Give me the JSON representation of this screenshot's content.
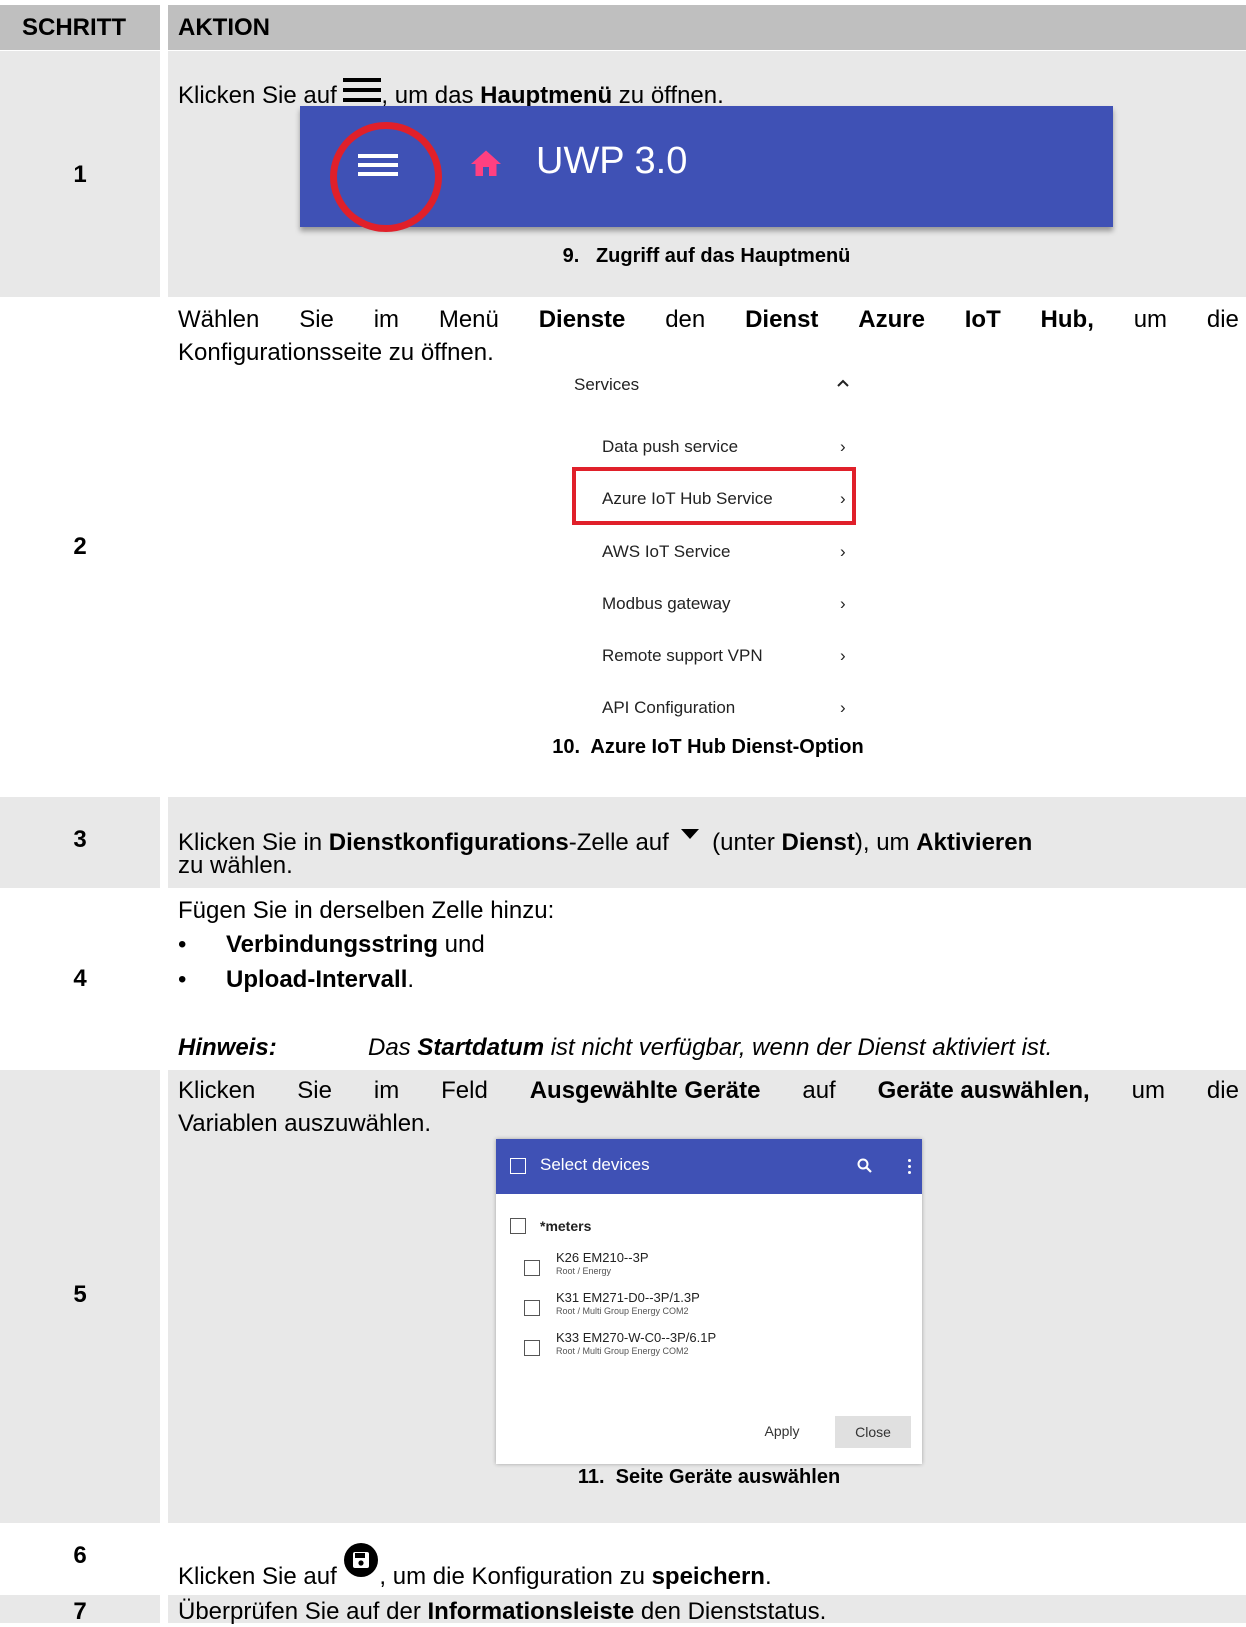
{
  "header": {
    "col_step": "SCHRITT",
    "col_action": "AKTION"
  },
  "step1": {
    "num": "1",
    "text_a": "Klicken Sie auf ",
    "text_b": ", um das ",
    "text_bold": "Hauptmenü",
    "text_c": " zu öffnen.",
    "app_title": "UWP 3.0",
    "caption": "9.   Zugriff auf das Hauptmenü"
  },
  "step2": {
    "num": "2",
    "line1": [
      "Wählen",
      "Sie",
      "im",
      "Menü",
      "Dienste",
      "den",
      "Dienst",
      "Azure",
      "IoT",
      "Hub,",
      "um",
      "die"
    ],
    "line2": "Konfigurationsseite zu öffnen.",
    "menu_header": "Services",
    "menu_items": [
      "Data push service",
      "Azure IoT Hub Service",
      "AWS IoT Service",
      "Modbus gateway",
      "Remote support VPN",
      "API Configuration"
    ],
    "caption": "10.  Azure IoT Hub Dienst-Option"
  },
  "step3": {
    "num": "3",
    "a": "Klicken Sie in ",
    "b": "Dienstkonfigurations",
    "c": "-Zelle auf ",
    "d": " (unter ",
    "e": "Dienst",
    "f": "), um ",
    "g": "Aktivieren",
    "line2": "zu wählen."
  },
  "step4": {
    "num": "4",
    "intro": "Fügen Sie in derselben Zelle hinzu:",
    "bullet1_bold": "Verbindungsstring",
    "bullet1_rest": " und",
    "bullet2_bold": "Upload-Intervall",
    "bullet2_rest": ".",
    "note_label": "Hinweis:",
    "note_a": "Das ",
    "note_bold": "Startdatum",
    "note_b": " ist nicht verfügbar, wenn der Dienst aktiviert ist."
  },
  "step5": {
    "num": "5",
    "line1": [
      "Klicken",
      "Sie",
      "im",
      "Feld",
      "Ausgewählte Geräte",
      "auf",
      "Geräte auswählen,",
      "um",
      "die"
    ],
    "line2": "Variablen auszuwählen.",
    "dialog_title": "Select devices",
    "group": "*meters",
    "devices": [
      {
        "name": "K26 EM210--3P",
        "path": "Root / Energy"
      },
      {
        "name": "K31 EM271-D0--3P/1.3P",
        "path": "Root / Multi Group Energy COM2"
      },
      {
        "name": "K33 EM270-W-C0--3P/6.1P",
        "path": "Root / Multi Group Energy COM2"
      }
    ],
    "apply": "Apply",
    "close": "Close",
    "caption": "11.  Seite Geräte auswählen"
  },
  "step6": {
    "num": "6",
    "a": "Klicken Sie auf ",
    "b": ", um die Konfiguration zu ",
    "c": "speichern",
    "d": "."
  },
  "step7": {
    "num": "7",
    "a": "Überprüfen Sie auf der ",
    "b": "Informationsleiste",
    "c": " den Dienststatus."
  },
  "colors": {
    "header_gray": "#bfbfbf",
    "row_gray": "#e8e8e8",
    "app_blue": "#3f51b5",
    "highlight_red": "#e0202a",
    "home_pink": "#ff4081"
  }
}
